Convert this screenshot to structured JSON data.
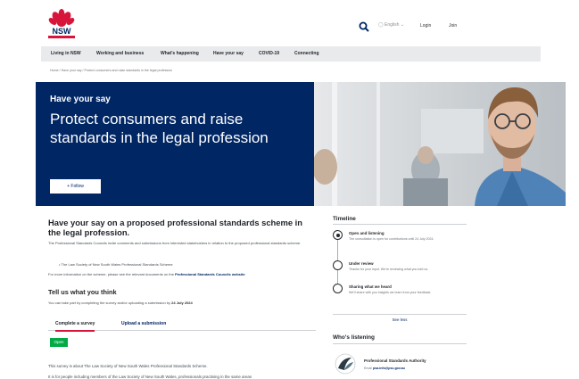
{
  "header": {
    "logo_text": "NSW",
    "language": "English",
    "login": "Login",
    "join": "Join"
  },
  "nav": {
    "items": [
      "Living in NSW",
      "Working and business",
      "What's happening",
      "Have your say",
      "COVID-19",
      "Connecting"
    ]
  },
  "breadcrumb": "Home  /  Have your say  /  Protect consumers and raise standards in the legal profession",
  "hero": {
    "kicker": "Have your say",
    "title": "Protect consumers and raise standards in the legal profession",
    "follow_label": "+  Follow"
  },
  "main": {
    "title": "Have your say on a proposed professional standards scheme in the legal profession.",
    "para": "The Professional Standards Councils invite comments and submissions from interested stakeholders in relation to the proposed professional standards scheme.",
    "bullet": "The Law Society of New South Wales Professional Standards Scheme",
    "more_info_prefix": "For more information on the scheme, please see the relevant documents on the ",
    "more_info_link": "Professional Standards Councils website",
    "tell_title": "Tell us what you think",
    "tell_para_prefix": "You can take part by completing the survey and/or uploading a submission by ",
    "tell_para_date": "24 July 2024",
    "tabs": [
      "Complete a survey",
      "Upload a submission"
    ],
    "badge": "Open",
    "survey_about": "This survey is about The Law Society of New South Wales Professional Standards Scheme.",
    "survey_cut": "It is for people including members of the Law Society of New South Wales, professionals practising in the same areas"
  },
  "timeline": {
    "heading": "Timeline",
    "stages": [
      {
        "name": "Open and listening",
        "desc": "The consultation is open for contributions until 24 July 2024."
      },
      {
        "name": "Under review",
        "desc": "Thanks for your input. We're reviewing what you told us."
      },
      {
        "name": "Sharing what we heard",
        "desc": "We'll share with you insights we learn from your feedback."
      }
    ],
    "see_less": "See less"
  },
  "whos_listening": {
    "heading": "Who's listening",
    "name": "Professional Standards Authority",
    "email_label": "Email ",
    "email": "psa.info@psc.gov.au"
  },
  "colors": {
    "brand_navy": "#002664",
    "brand_red": "#d7153a",
    "open_green": "#00aa45"
  }
}
